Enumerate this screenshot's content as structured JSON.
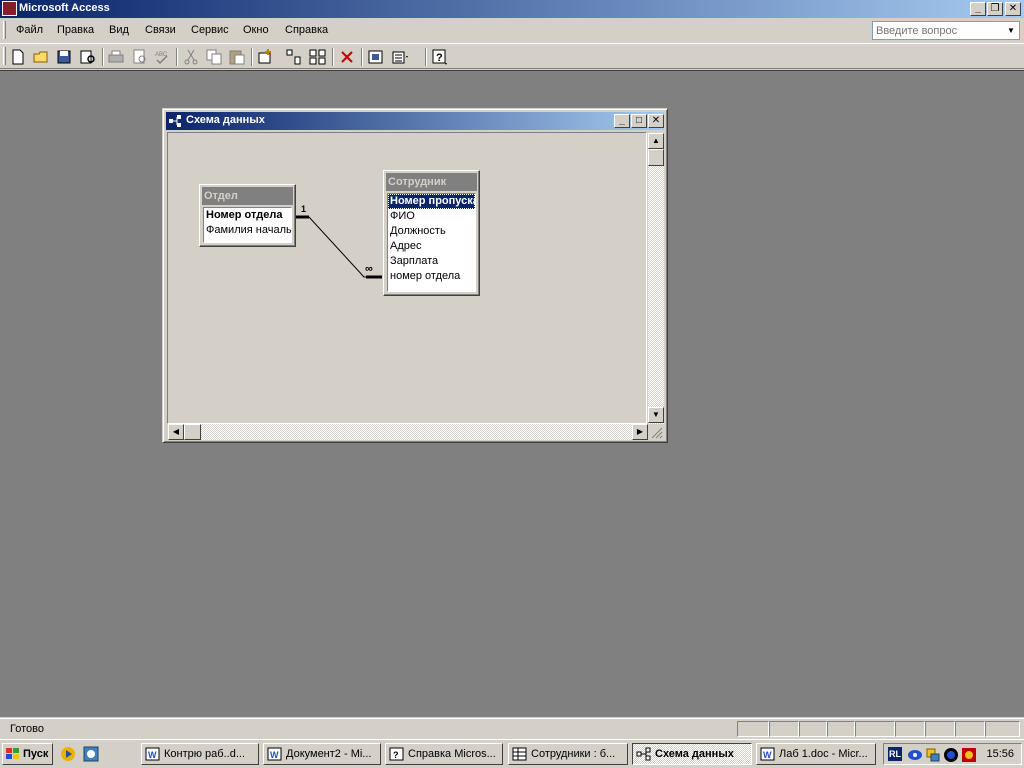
{
  "app": {
    "title": "Microsoft Access"
  },
  "menu": [
    "Файл",
    "Правка",
    "Вид",
    "Связи",
    "Сервис",
    "Окно",
    "Справка"
  ],
  "help_box": {
    "placeholder": "Введите вопрос"
  },
  "toolbar_icons": [
    "new-icon",
    "open-icon",
    "save-icon",
    "print-preview-icon",
    "print-icon",
    "preview-icon",
    "spelling-icon",
    "cut-icon",
    "copy-icon",
    "paste-icon",
    "show-table-icon",
    "show-direct-icon",
    "show-all-icon",
    "delete-icon",
    "new-object-icon",
    "properties-icon",
    "help-icon"
  ],
  "child_window": {
    "title": "Схема данных"
  },
  "relationship": {
    "one_label": "1",
    "many_label": "∞"
  },
  "tables": {
    "otdel": {
      "title": "Отдел",
      "fields": [
        "Номер отдела",
        "Фамилия началь"
      ]
    },
    "sotrudnik": {
      "title": "Сотрудник",
      "fields": [
        "Номер пропуска",
        "ФИО",
        "Должность",
        "Адрес",
        "Зарплата",
        "номер отдела"
      ]
    }
  },
  "status": {
    "text": "Готово"
  },
  "taskbar": {
    "start": "Пуск",
    "tasks": [
      "Контрю раб..d...",
      "Документ2 - Mi...",
      "Справка Micros...",
      "Сотрудники : б...",
      "Схема данных",
      "Лаб 1.doc - Micr..."
    ],
    "tray_lang": "RL",
    "clock": "15:56"
  },
  "colors": {
    "title_start": "#0a246a",
    "title_end": "#a6caf0",
    "desktop": "#808080",
    "face": "#d4d0c8"
  }
}
